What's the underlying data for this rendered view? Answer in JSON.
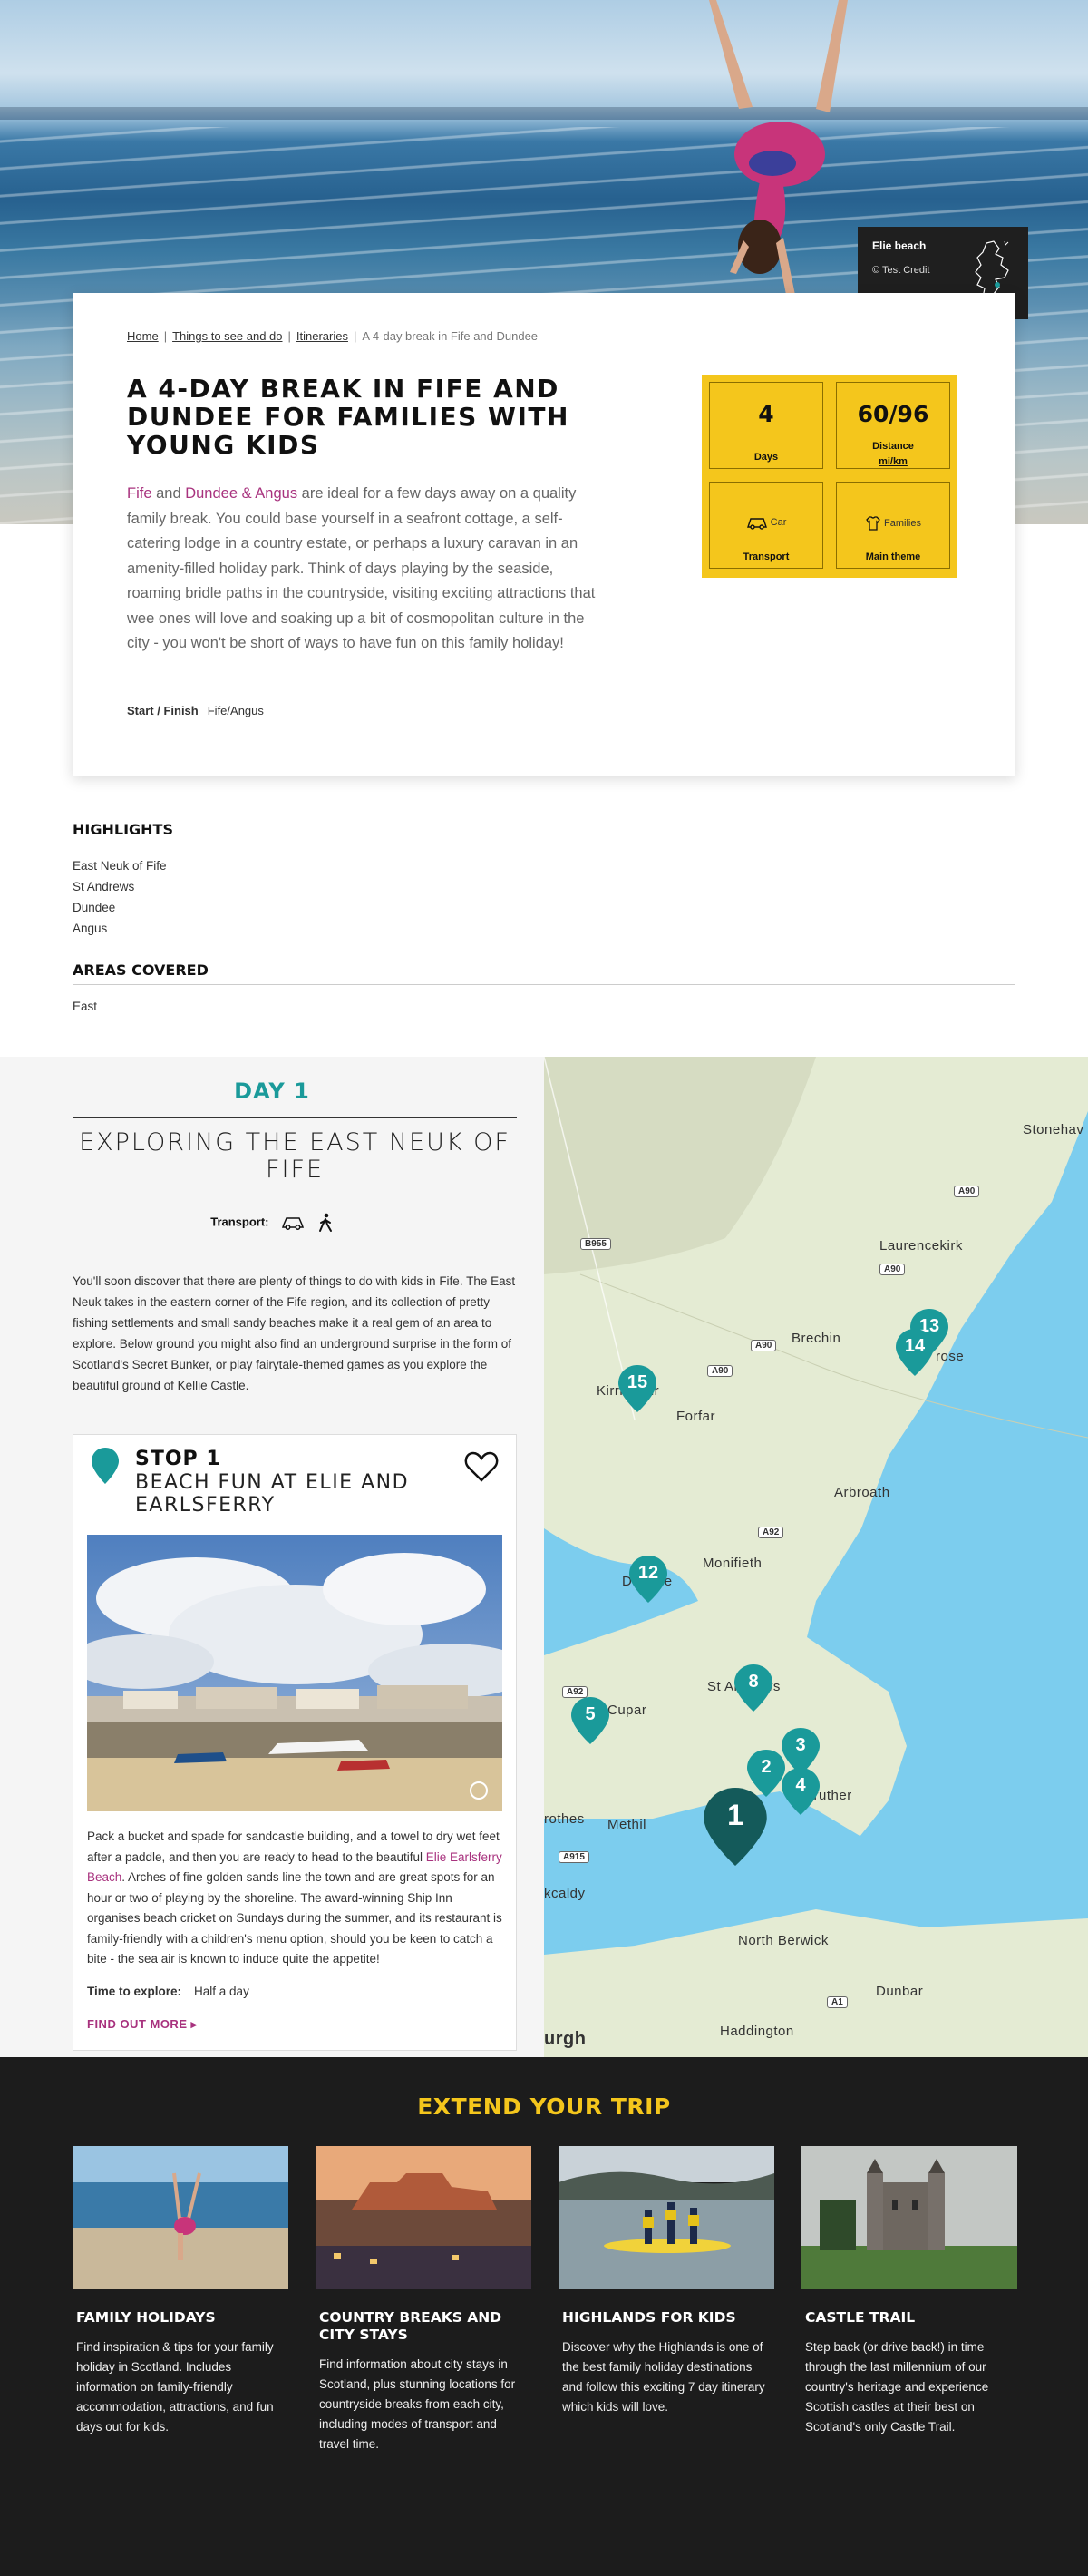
{
  "hero": {
    "photo_credit_title": "Elie beach",
    "photo_credit_source": "© Test Credit"
  },
  "breadcrumb": {
    "items": [
      "Home",
      "Things to see and do",
      "Itineraries"
    ],
    "current": "A 4-day break in Fife and Dundee"
  },
  "page": {
    "title": "A 4-DAY BREAK IN FIFE AND DUNDEE FOR FAMILIES WITH YOUNG KIDS",
    "intro_link1": "Fife",
    "intro_and": " and ",
    "intro_link2": "Dundee & Angus",
    "intro_text": " are ideal for a few days away on a quality family break. You could base yourself in a seafront cottage, a self-catering lodge in a country estate, or perhaps a luxury caravan in an amenity-filled holiday park. Think of days playing by the seaside, roaming bridle paths in the countryside, visiting exciting attractions that wee ones will love and soaking up a bit of cosmopolitan culture in the city - you won't be short of ways to have fun on this family holiday!",
    "start_finish_label": "Start / Finish",
    "start_finish_value": "Fife/Angus"
  },
  "stats": {
    "days_value": "4",
    "days_label": "Days",
    "distance_value": "60/96",
    "distance_label": "Distance",
    "distance_unit": "mi/km",
    "transport_value": "Car",
    "transport_label": "Transport",
    "theme_value": "Families",
    "theme_label": "Main theme"
  },
  "highlights": {
    "heading": "HIGHLIGHTS",
    "items": [
      "East Neuk of Fife",
      "St Andrews",
      "Dundee",
      "Angus"
    ]
  },
  "areas": {
    "heading": "AREAS COVERED",
    "items": [
      "East"
    ]
  },
  "day": {
    "number": "DAY 1",
    "title": "EXPLORING THE EAST NEUK OF FIFE",
    "transport_label": "Transport:",
    "description": "You'll soon discover that there are plenty of things to do with kids in Fife. The East Neuk takes in the eastern corner of the Fife region, and its collection of pretty fishing settlements and small sandy beaches make it a real gem of an area to explore. Below ground you might also find an underground surprise in the form of Scotland's Secret Bunker, or play fairytale-themed games as you explore the beautiful ground of Kellie Castle."
  },
  "stop": {
    "number": "STOP 1",
    "title": "BEACH FUN AT ELIE AND EARLSFERRY",
    "desc_before": "Pack a bucket and spade for sandcastle building, and a towel to dry wet feet after a paddle, and then you are ready to head to the beautiful ",
    "desc_link": "Elie Earlsferry Beach",
    "desc_after": ". Arches of fine golden sands line the town and are great spots for an hour or two of playing by the shoreline. The award-winning Ship Inn organises beach cricket on Sundays during the summer, and its restaurant is family-friendly with a children's menu option, should you be keen to catch a bite - the sea air is known to induce quite the appetite!",
    "time_label": "Time to explore:",
    "time_value": "Half a day",
    "find_out_more": "FIND OUT MORE ▸"
  },
  "map": {
    "places": [
      "Stonehav",
      "Laurencekirk",
      "Brechin",
      "Kirriemuir",
      "Forfar",
      "rose",
      "Arbroath",
      "Monifieth",
      "Dundee",
      "St Andrews",
      "Cupar",
      "Methil",
      "rothes",
      "kcaldy",
      "North Berwick",
      "Dunbar",
      "Haddington",
      "urgh",
      "nstruther"
    ],
    "roads": [
      "A90",
      "A90",
      "B955",
      "A90",
      "A90",
      "A92",
      "A92",
      "A915",
      "A1"
    ],
    "markers": [
      "13",
      "14",
      "15",
      "12",
      "8",
      "5",
      "3",
      "2",
      "4",
      "1"
    ]
  },
  "extend": {
    "heading": "EXTEND YOUR TRIP",
    "tiles": [
      {
        "title": "FAMILY HOLIDAYS",
        "desc": "Find inspiration & tips for your family holiday in Scotland. Includes information on family-friendly accommodation, attractions, and fun days out for kids."
      },
      {
        "title": "COUNTRY BREAKS AND CITY STAYS",
        "desc": "Find information about city stays in Scotland, plus stunning locations for countryside breaks from each city, including modes of transport and travel time."
      },
      {
        "title": "HIGHLANDS FOR KIDS",
        "desc": "Discover why the Highlands is one of the best family holiday destinations and follow this exciting 7 day itinerary which kids will love."
      },
      {
        "title": "CASTLE TRAIL",
        "desc": "Step back (or drive back!) in time through the last millennium of our country's heritage and experience Scottish castles at their best on Scotland's only Castle Trail."
      }
    ]
  },
  "colors": {
    "accent_teal": "#1a9a9a",
    "accent_yellow": "#f4c61c",
    "link_purple": "#a8327e",
    "footer_dark": "#1c1c1c"
  }
}
